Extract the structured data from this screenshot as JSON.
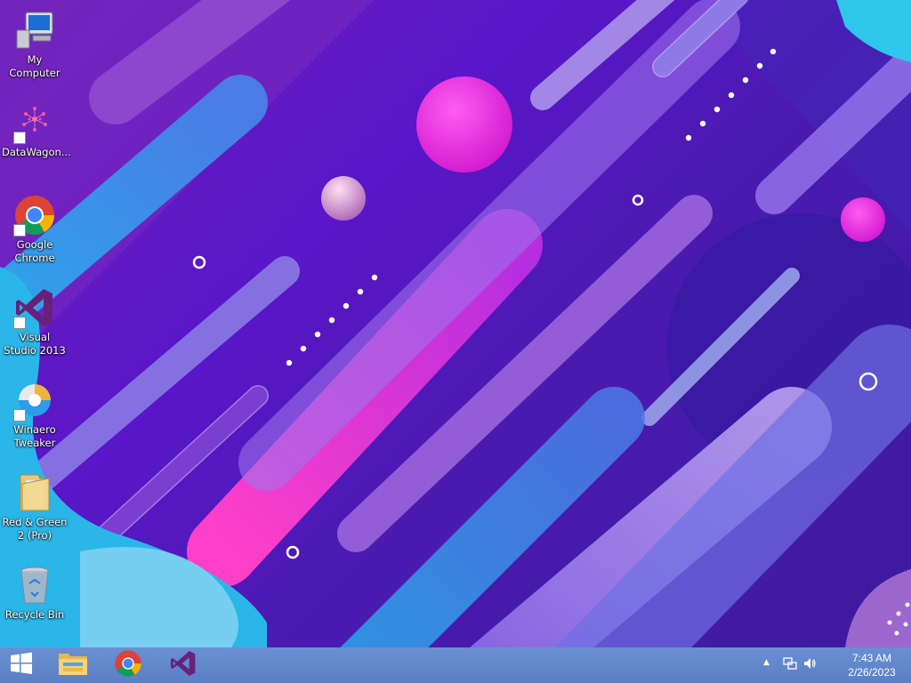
{
  "desktop": {
    "icons": [
      {
        "label": "My Computer",
        "icon": "computer-icon"
      },
      {
        "label": "DataWagon...",
        "icon": "datawagon-icon"
      },
      {
        "label": "Google Chrome",
        "icon": "chrome-icon"
      },
      {
        "label": "Visual Studio 2013",
        "icon": "visual-studio-icon"
      },
      {
        "label": "Winaero Tweaker",
        "icon": "winaero-tweaker-icon"
      },
      {
        "label": "Red & Green 2 (Pro)",
        "icon": "folder-icon"
      },
      {
        "label": "Recycle Bin",
        "icon": "recycle-bin-icon"
      }
    ]
  },
  "taskbar": {
    "pinned": [
      {
        "name": "start-button",
        "icon": "windows-logo-icon"
      },
      {
        "name": "file-explorer",
        "icon": "file-explorer-icon"
      },
      {
        "name": "google-chrome",
        "icon": "chrome-icon"
      },
      {
        "name": "visual-studio",
        "icon": "visual-studio-icon"
      }
    ],
    "tray": {
      "overflow_glyph": "▲",
      "icons": [
        "network-icon",
        "volume-icon"
      ]
    },
    "clock": {
      "time": "7:43 AM",
      "date": "2/26/2023"
    }
  },
  "colors": {
    "wallpaper_base": "#5a16c9",
    "taskbar": "#5b7fc4",
    "accent_magenta": "#e52fd8",
    "accent_cyan": "#2ab8e8"
  }
}
